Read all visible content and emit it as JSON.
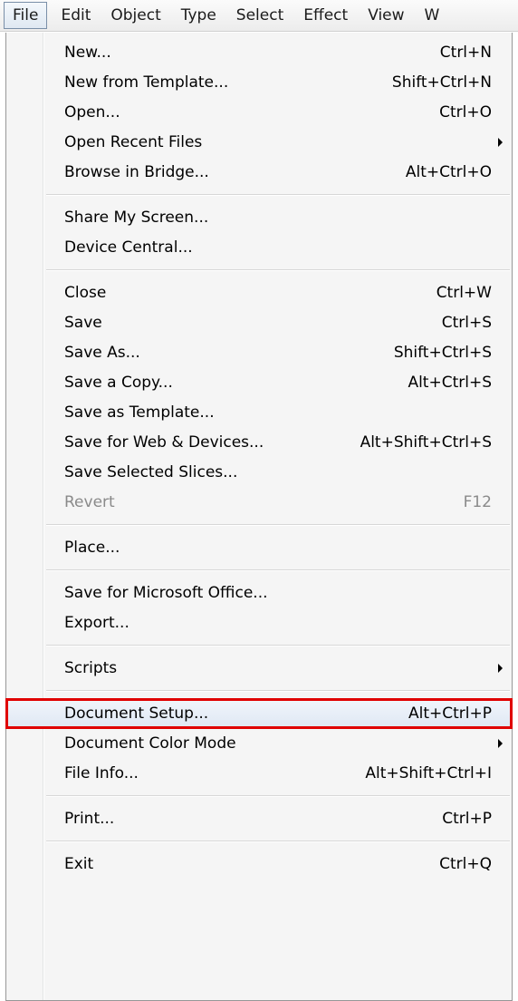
{
  "menubar": {
    "items": [
      {
        "label": "File"
      },
      {
        "label": "Edit"
      },
      {
        "label": "Object"
      },
      {
        "label": "Type"
      },
      {
        "label": "Select"
      },
      {
        "label": "Effect"
      },
      {
        "label": "View"
      },
      {
        "label": "W"
      }
    ]
  },
  "file_menu": {
    "items": [
      {
        "label": "New...",
        "shortcut": "Ctrl+N"
      },
      {
        "label": "New from Template...",
        "shortcut": "Shift+Ctrl+N"
      },
      {
        "label": "Open...",
        "shortcut": "Ctrl+O"
      },
      {
        "label": "Open Recent Files",
        "shortcut": ""
      },
      {
        "label": "Browse in Bridge...",
        "shortcut": "Alt+Ctrl+O"
      },
      {
        "label": "Share My Screen...",
        "shortcut": ""
      },
      {
        "label": "Device Central...",
        "shortcut": ""
      },
      {
        "label": "Close",
        "shortcut": "Ctrl+W"
      },
      {
        "label": "Save",
        "shortcut": "Ctrl+S"
      },
      {
        "label": "Save As...",
        "shortcut": "Shift+Ctrl+S"
      },
      {
        "label": "Save a Copy...",
        "shortcut": "Alt+Ctrl+S"
      },
      {
        "label": "Save as Template...",
        "shortcut": ""
      },
      {
        "label": "Save for Web & Devices...",
        "shortcut": "Alt+Shift+Ctrl+S"
      },
      {
        "label": "Save Selected Slices...",
        "shortcut": ""
      },
      {
        "label": "Revert",
        "shortcut": "F12"
      },
      {
        "label": "Place...",
        "shortcut": ""
      },
      {
        "label": "Save for Microsoft Office...",
        "shortcut": ""
      },
      {
        "label": "Export...",
        "shortcut": ""
      },
      {
        "label": "Scripts",
        "shortcut": ""
      },
      {
        "label": "Document Setup...",
        "shortcut": "Alt+Ctrl+P"
      },
      {
        "label": "Document Color Mode",
        "shortcut": ""
      },
      {
        "label": "File Info...",
        "shortcut": "Alt+Shift+Ctrl+I"
      },
      {
        "label": "Print...",
        "shortcut": "Ctrl+P"
      },
      {
        "label": "Exit",
        "shortcut": "Ctrl+Q"
      }
    ]
  },
  "colors": {
    "highlight_border": "#e00000",
    "menu_background": "#f5f5f5",
    "disabled_text": "#8a8a8a"
  }
}
